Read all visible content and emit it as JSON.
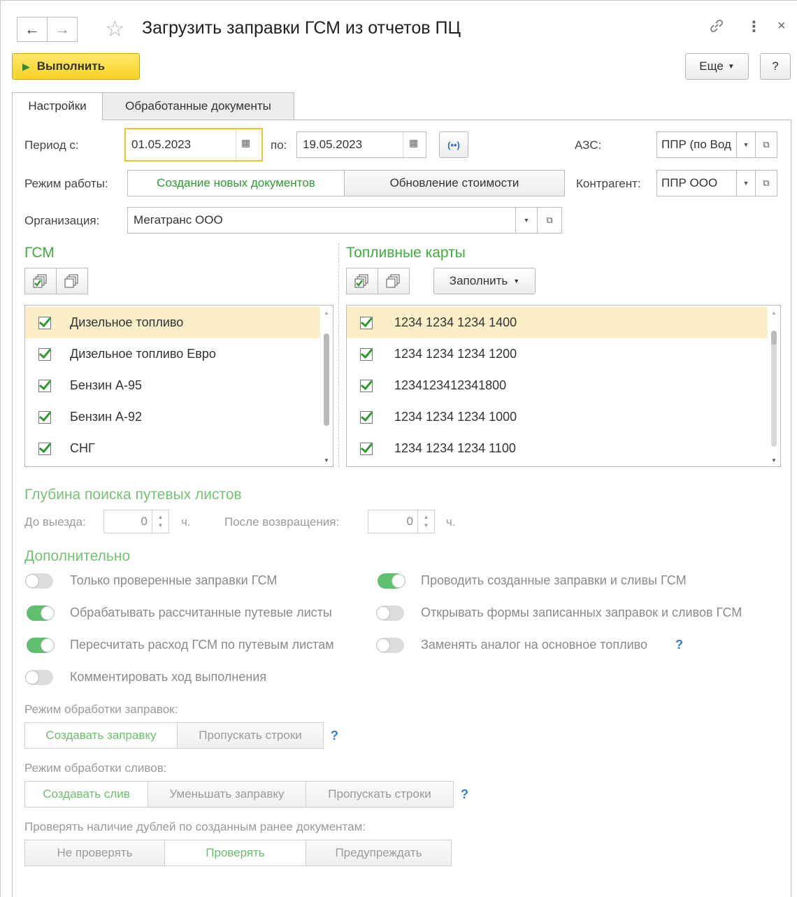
{
  "window": {
    "title": "Загрузить заправки ГСМ из отчетов ПЦ",
    "back_symbol": "←",
    "forward_symbol": "→",
    "star_symbol": "☆",
    "link_symbol": "⛓",
    "more_symbol": "⋮",
    "close_symbol": "×"
  },
  "toolbar": {
    "run_label": "Выполнить",
    "more_label": "Еще",
    "help_label": "?"
  },
  "tabs": [
    {
      "label": "Настройки",
      "active": true
    },
    {
      "label": "Обработанные документы",
      "active": false
    }
  ],
  "period": {
    "from_label": "Период с:",
    "from_value": "01.05.2023",
    "to_label": "по:",
    "to_value": "19.05.2023"
  },
  "azs": {
    "label": "АЗС:",
    "value": "ППР (по Вод"
  },
  "mode": {
    "label": "Режим работы:",
    "options": [
      "Создание новых документов",
      "Обновление стоимости"
    ],
    "selected": "Создание новых документов"
  },
  "counterparty": {
    "label": "Контрагент:",
    "value": "ППР ООО"
  },
  "organization": {
    "label": "Организация:",
    "value": "Мегатранс ООО"
  },
  "gsm": {
    "title": "ГСМ",
    "items": [
      {
        "label": "Дизельное топливо",
        "checked": true,
        "selected": true
      },
      {
        "label": "Дизельное топливо Евро",
        "checked": true,
        "selected": false
      },
      {
        "label": "Бензин А-95",
        "checked": true,
        "selected": false
      },
      {
        "label": "Бензин А-92",
        "checked": true,
        "selected": false
      },
      {
        "label": "СНГ",
        "checked": true,
        "selected": false
      }
    ]
  },
  "cards": {
    "title": "Топливные карты",
    "fill_label": "Заполнить",
    "items": [
      {
        "label": "1234 1234 1234 1400",
        "checked": true,
        "selected": true
      },
      {
        "label": "1234 1234 1234 1200",
        "checked": true,
        "selected": false
      },
      {
        "label": "1234123412341800",
        "checked": true,
        "selected": false
      },
      {
        "label": "1234 1234 1234 1000",
        "checked": true,
        "selected": false
      },
      {
        "label": "1234 1234 1234 1100",
        "checked": true,
        "selected": false
      }
    ]
  },
  "depth": {
    "title": "Глубина поиска путевых листов",
    "before_label": "До выезда:",
    "before_value": "0",
    "after_label": "После возвращения:",
    "after_value": "0",
    "unit": "ч."
  },
  "extra": {
    "title": "Дополнительно",
    "options": [
      {
        "label": "Только проверенные заправки ГСМ",
        "on": false
      },
      {
        "label": "Обрабатывать рассчитанные путевые листы",
        "on": true
      },
      {
        "label": "Пересчитать расход ГСМ по путевым листам",
        "on": true
      },
      {
        "label": "Комментировать ход выполнения",
        "on": false
      },
      {
        "label": "Проводить созданные заправки и сливы ГСМ",
        "on": true
      },
      {
        "label": "Открывать формы записанных заправок и сливов ГСМ",
        "on": false
      },
      {
        "label": "Заменять аналог на основное топливо",
        "on": false
      }
    ],
    "help_mark": "?"
  },
  "refuel_mode": {
    "label": "Режим обработки заправок:",
    "options": [
      "Создавать заправку",
      "Пропускать строки"
    ],
    "selected": "Создавать заправку"
  },
  "drain_mode": {
    "label": "Режим обработки сливов:",
    "options": [
      "Создавать слив",
      "Уменьшать заправку",
      "Пропускать строки"
    ],
    "selected": "Создавать слив"
  },
  "duplicates": {
    "label": "Проверять наличие дублей по созданным ранее документам:",
    "options": [
      "Не проверять",
      "Проверять",
      "Предупреждать"
    ],
    "selected": "Проверять"
  }
}
